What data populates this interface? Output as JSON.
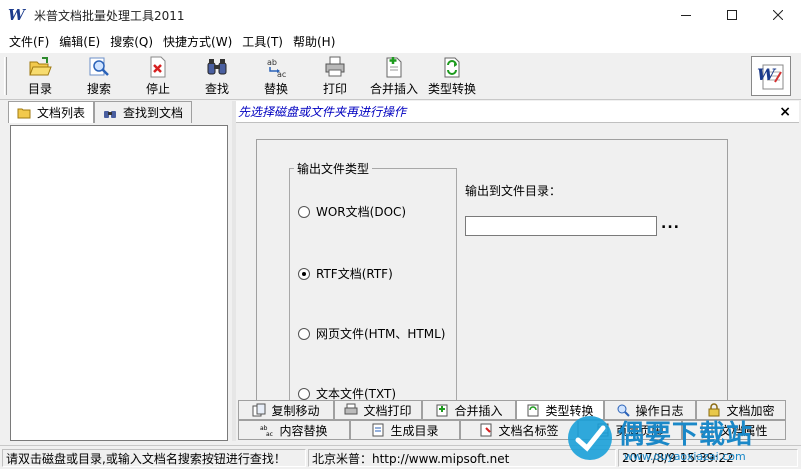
{
  "window": {
    "title": "米普文档批量处理工具2011"
  },
  "menu": [
    "文件(F)",
    "编辑(E)",
    "搜索(Q)",
    "快捷方式(W)",
    "工具(T)",
    "帮助(H)"
  ],
  "toolbar": {
    "items": [
      {
        "label": "目录",
        "icon": "folder-open-icon"
      },
      {
        "label": "搜索",
        "icon": "magnifier-icon"
      },
      {
        "label": "停止",
        "icon": "stop-icon"
      },
      {
        "label": "查找",
        "icon": "binoculars-icon"
      },
      {
        "label": "替换",
        "icon": "replace-icon"
      },
      {
        "label": "打印",
        "icon": "printer-icon"
      },
      {
        "label": "合并插入",
        "icon": "merge-insert-icon"
      },
      {
        "label": "类型转换",
        "icon": "convert-icon"
      }
    ]
  },
  "left_panel": {
    "tabs": [
      {
        "label": "文档列表",
        "icon": "folder-icon",
        "active": true
      },
      {
        "label": "查找到文档",
        "icon": "binoculars-icon",
        "active": false
      }
    ]
  },
  "right_panel": {
    "hint": "先选择磁盘或文件夹再进行操作",
    "group_title": "输出文件类型",
    "options": [
      {
        "label": "WOR文档(DOC)",
        "checked": false
      },
      {
        "label": "RTF文档(RTF)",
        "checked": true
      },
      {
        "label": "网页文件(HTM、HTML)",
        "checked": false
      },
      {
        "label": "文本文件(TXT)",
        "checked": false
      }
    ],
    "output_dir_label": "输出到文件目录：",
    "output_dir_value": "",
    "browse": "..."
  },
  "bottom_tabs_row1": [
    {
      "label": "复制移动",
      "icon": "copy-move-icon"
    },
    {
      "label": "文档打印",
      "icon": "printer-icon"
    },
    {
      "label": "合并插入",
      "icon": "merge-insert-icon"
    },
    {
      "label": "类型转换",
      "icon": "convert-icon",
      "selected": true
    },
    {
      "label": "操作日志",
      "icon": "log-icon"
    },
    {
      "label": "文档加密",
      "icon": "lock-icon"
    }
  ],
  "bottom_tabs_row2": [
    {
      "label": "内容替换",
      "icon": "replace-icon"
    },
    {
      "label": "生成目录",
      "icon": "catalog-icon"
    },
    {
      "label": "文档名标签",
      "icon": "tag-icon"
    },
    {
      "label": "页眉页脚",
      "icon": "header-footer-icon"
    },
    {
      "label": "文档属性",
      "icon": "properties-icon"
    }
  ],
  "status": {
    "hint": "请双击磁盘或目录,或输入文档名搜索按钮进行查找！",
    "vendor": "北京米普：http://www.mipsoft.net",
    "datetime": "2017/8/9 15:39:22"
  },
  "watermark": {
    "text": "偶要下载站",
    "url": "www.ouyaoxiazai.com"
  },
  "colors": {
    "hint_text": "#0000c0",
    "title_bg": "#ffffff",
    "chrome": "#f0f0f0"
  }
}
